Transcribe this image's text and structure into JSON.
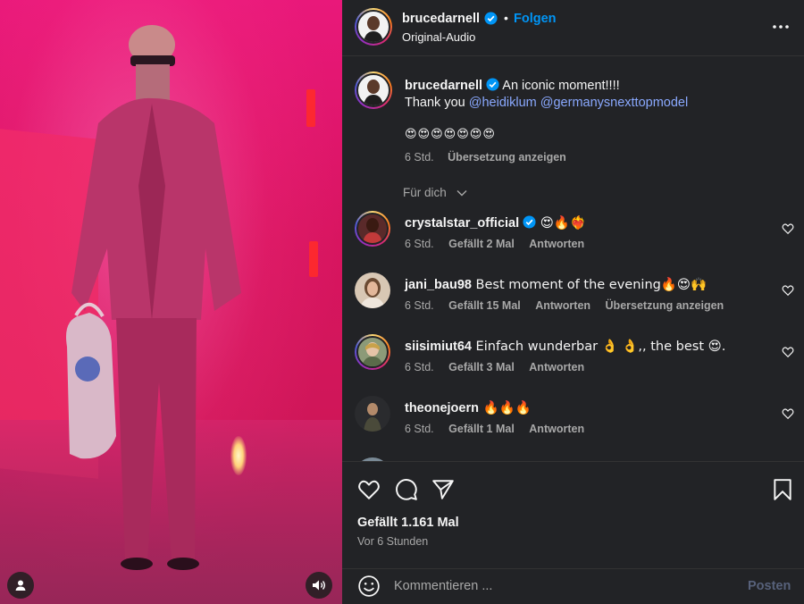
{
  "media": {
    "description_icons": [
      "user-tag-icon",
      "speaker-icon"
    ]
  },
  "header": {
    "username": "brucedarnell",
    "dot": "•",
    "follow_label": "Folgen",
    "audio": "Original-Audio"
  },
  "caption": {
    "username": "brucedarnell",
    "text_line1": " An iconic moment!!!!",
    "thank_you": "Thank you ",
    "mention1": "@heidiklum",
    "mention2": "@germanysnexttopmodel",
    "emojis": "😍😍😍😍😍😍😍",
    "time": "6 Std.",
    "translate": "Übersetzung anzeigen"
  },
  "filter": {
    "label": "Für dich"
  },
  "comments": [
    {
      "username": "crystalstar_official",
      "verified": true,
      "text": " 😍🔥❤️‍🔥",
      "time": "6 Std.",
      "likes": "Gefällt 2 Mal",
      "reply": "Antworten",
      "translate": ""
    },
    {
      "username": "jani_bau98",
      "verified": false,
      "text": " Best moment of the evening🔥😍🙌",
      "time": "6 Std.",
      "likes": "Gefällt 15 Mal",
      "reply": "Antworten",
      "translate": "Übersetzung anzeigen"
    },
    {
      "username": "siisimiut64",
      "verified": false,
      "text": " Einfach wunderbar 👌 👌,, the best 😍.",
      "time": "6 Std.",
      "likes": "Gefällt 3 Mal",
      "reply": "Antworten",
      "translate": ""
    },
    {
      "username": "theonejoern",
      "verified": false,
      "text": " 🔥🔥🔥",
      "time": "6 Std.",
      "likes": "Gefällt 1 Mal",
      "reply": "Antworten",
      "translate": ""
    }
  ],
  "actions": {
    "likes": "Gefällt 1.161 Mal",
    "time": "Vor 6 Stunden"
  },
  "comment_box": {
    "placeholder": "Kommentieren ...",
    "post_label": "Posten"
  },
  "colors": {
    "panel_bg": "#222326",
    "link": "#0095f6",
    "mention": "#8aa9ff",
    "muted": "#a8a8a8",
    "post_disabled": "#57617a"
  }
}
